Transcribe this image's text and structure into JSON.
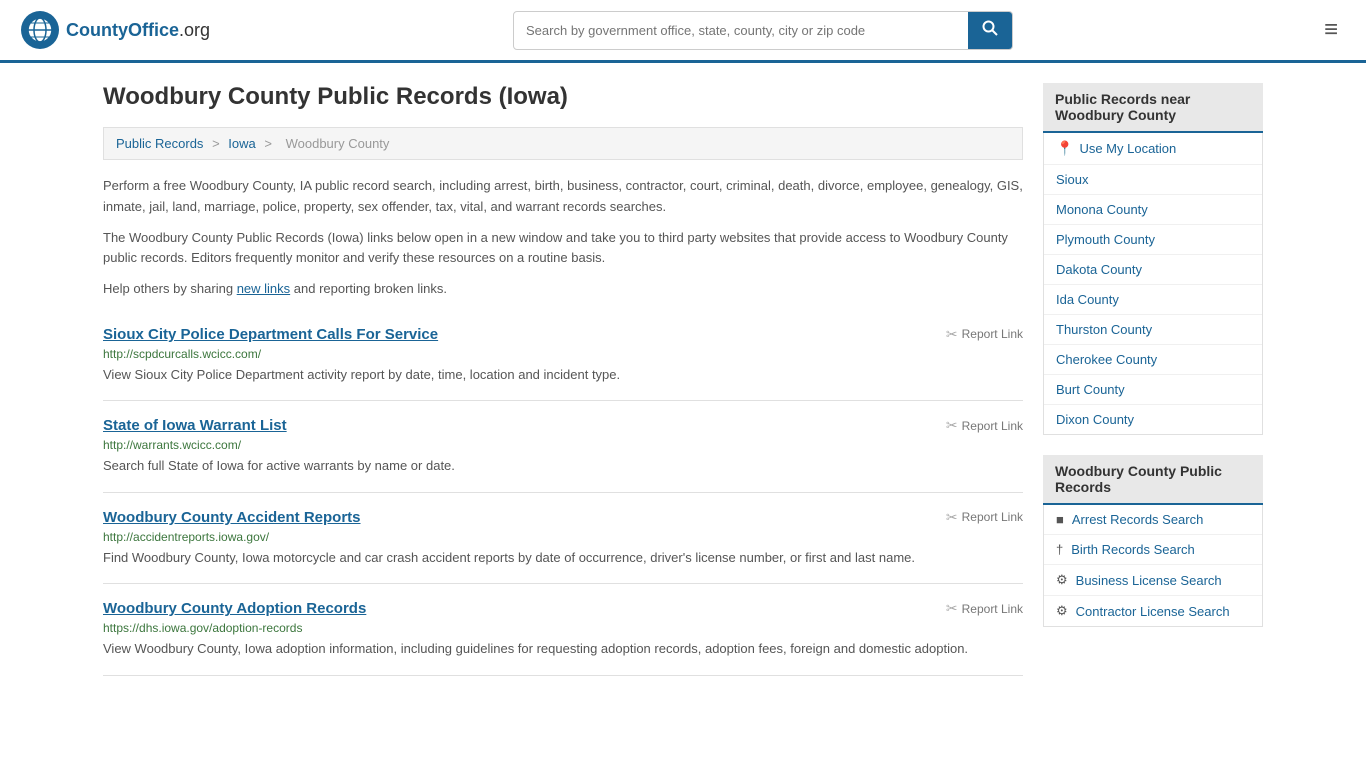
{
  "header": {
    "logo_text": "CountyOffice",
    "logo_suffix": ".org",
    "search_placeholder": "Search by government office, state, county, city or zip code",
    "search_icon": "🔍",
    "menu_icon": "≡"
  },
  "page": {
    "title": "Woodbury County Public Records (Iowa)",
    "breadcrumb": {
      "items": [
        "Public Records",
        "Iowa",
        "Woodbury County"
      ],
      "separators": [
        ">",
        ">"
      ]
    },
    "intro_paragraph_1": "Perform a free Woodbury County, IA public record search, including arrest, birth, business, contractor, court, criminal, death, divorce, employee, genealogy, GIS, inmate, jail, land, marriage, police, property, sex offender, tax, vital, and warrant records searches.",
    "intro_paragraph_2": "The Woodbury County Public Records (Iowa) links below open in a new window and take you to third party websites that provide access to Woodbury County public records. Editors frequently monitor and verify these resources on a routine basis.",
    "intro_paragraph_3_prefix": "Help others by sharing ",
    "intro_link_text": "new links",
    "intro_paragraph_3_suffix": " and reporting broken links."
  },
  "records": [
    {
      "title": "Sioux City Police Department Calls For Service",
      "url": "http://scpdcurcalls.wcicc.com/",
      "description": "View Sioux City Police Department activity report by date, time, location and incident type.",
      "report_label": "Report Link"
    },
    {
      "title": "State of Iowa Warrant List",
      "url": "http://warrants.wcicc.com/",
      "description": "Search full State of Iowa for active warrants by name or date.",
      "report_label": "Report Link"
    },
    {
      "title": "Woodbury County Accident Reports",
      "url": "http://accidentreports.iowa.gov/",
      "description": "Find Woodbury County, Iowa motorcycle and car crash accident reports by date of occurrence, driver's license number, or first and last name.",
      "report_label": "Report Link"
    },
    {
      "title": "Woodbury County Adoption Records",
      "url": "https://dhs.iowa.gov/adoption-records",
      "description": "View Woodbury County, Iowa adoption information, including guidelines for requesting adoption records, adoption fees, foreign and domestic adoption.",
      "report_label": "Report Link"
    }
  ],
  "sidebar": {
    "nearby_title": "Public Records near Woodbury County",
    "use_my_location": "Use My Location",
    "nearby_items": [
      "Sioux",
      "Monona County",
      "Plymouth County",
      "Dakota County",
      "Ida County",
      "Thurston County",
      "Cherokee County",
      "Burt County",
      "Dixon County"
    ],
    "public_records_title": "Woodbury County Public Records",
    "public_records_items": [
      {
        "label": "Arrest Records Search",
        "icon": "■"
      },
      {
        "label": "Birth Records Search",
        "icon": "†"
      },
      {
        "label": "Business License Search",
        "icon": "⚙"
      },
      {
        "label": "Contractor License Search",
        "icon": "⚙"
      }
    ]
  }
}
